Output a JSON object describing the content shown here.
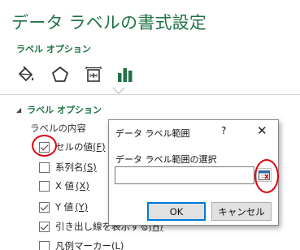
{
  "pane": {
    "title": "データ ラベルの書式設定",
    "subtitle": "ラベル オプション",
    "tabs": [
      {
        "icon": "paint-bucket-icon"
      },
      {
        "icon": "pentagon-icon"
      },
      {
        "icon": "size-properties-icon"
      },
      {
        "icon": "bar-chart-icon",
        "selected": true
      }
    ],
    "section_header": "ラベル オプション",
    "group_label": "ラベルの内容",
    "options": [
      {
        "pre": "",
        "text": "セルの値",
        "key": "(F)",
        "checked": true
      },
      {
        "pre": "系列名",
        "text": "",
        "key": "(S)",
        "checked": false
      },
      {
        "pre": "X 値",
        "text": "",
        "key": "(X)",
        "checked": false
      },
      {
        "pre": "Y 値",
        "text": "",
        "key": "(Y)",
        "checked": true
      },
      {
        "pre": "引き出し線を表示する",
        "text": "",
        "key": "(H)",
        "checked": true
      },
      {
        "pre": "凡例マーカー",
        "text": "",
        "key": "(L)",
        "checked": false
      }
    ]
  },
  "dialog": {
    "title": "データ ラベル範囲",
    "help": "?",
    "close": "✕",
    "label": "データ ラベル範囲の選択",
    "range_value": "",
    "ok_label": "OK",
    "cancel_label": "キャンセル"
  },
  "colors": {
    "accent_green": "#217346",
    "annotation_red": "#e3000f",
    "focus_blue": "#0078d7"
  }
}
